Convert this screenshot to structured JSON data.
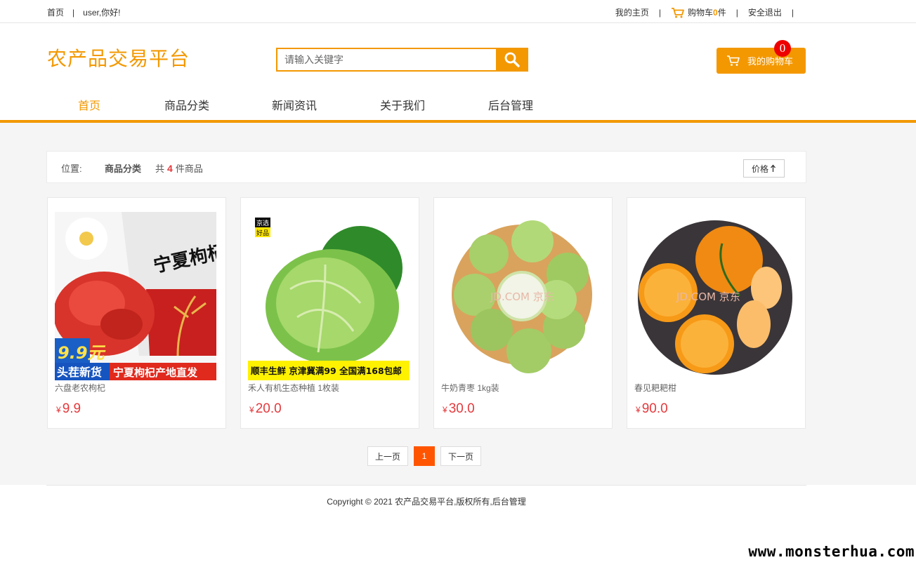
{
  "topbar": {
    "home": "首页",
    "greeting": "user,你好!",
    "my_home": "我的主页",
    "cart_label": "购物车",
    "cart_count": "0",
    "cart_unit": "件",
    "logout": "安全退出"
  },
  "header": {
    "logo": "农产品交易平台",
    "search_placeholder": "请输入关键字",
    "mycart_label": "我的购物车",
    "mycart_badge": "0"
  },
  "nav": {
    "items": [
      "首页",
      "商品分类",
      "新闻资讯",
      "关于我们",
      "后台管理"
    ],
    "active": "首页"
  },
  "crumb": {
    "position_label": "位置:",
    "category": "商品分类",
    "total_prefix": "共",
    "total": "4",
    "total_suffix": "件商品",
    "sort_label": "价格"
  },
  "products": [
    {
      "name": "六盘老农枸杞",
      "currency": "¥",
      "price": "9.9",
      "img_text": [
        "宁夏枸杞",
        "9.9元",
        "头茬新货",
        "宁夏枸杞产地直发"
      ]
    },
    {
      "name": "禾人有机生态种植 1枚装",
      "currency": "¥",
      "price": "20.0",
      "img_text": [
        "京选",
        "好品",
        "顺丰生鲜 京津冀满99 全国满168包邮"
      ]
    },
    {
      "name": "牛奶青枣 1kg装",
      "currency": "¥",
      "price": "30.0",
      "img_text": [
        "JD.COM 京东"
      ]
    },
    {
      "name": "春见耙耙柑",
      "currency": "¥",
      "price": "90.0",
      "img_text": [
        "JD.COM 京东"
      ]
    }
  ],
  "pager": {
    "prev": "上一页",
    "current": "1",
    "next": "下一页"
  },
  "footer": {
    "copyright": "Copyright © 2021 农产品交易平台,版权所有,后台管理"
  },
  "watermark": "www.monsterhua.com",
  "colors": {
    "accent": "#f39800",
    "price": "#e4393c",
    "pager_active": "#ff5500",
    "badge": "#ee0000"
  },
  "icons": [
    "cart-icon",
    "search-icon",
    "arrow-up-icon"
  ]
}
